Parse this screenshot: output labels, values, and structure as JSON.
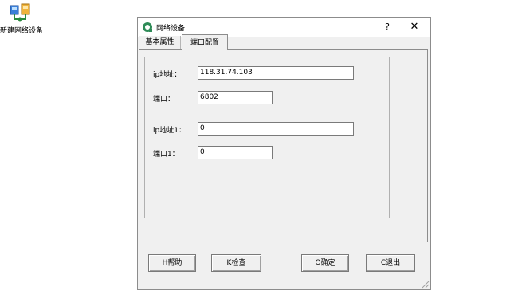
{
  "desktop": {
    "icon_name": "network-device-icon",
    "label": "新建网络设备"
  },
  "dialog": {
    "title": "网络设备",
    "help_glyph": "?",
    "close_glyph": "✕",
    "tabs": [
      {
        "label": "基本属性",
        "active": false
      },
      {
        "label": "端口配置",
        "active": true
      }
    ],
    "fields": {
      "ip_label": "ip地址：",
      "ip_value": "118.31.74.103",
      "port_label": "端口：",
      "port_value": "6802",
      "ip1_label": "ip地址1：",
      "ip1_value": "0",
      "port1_label": "端口1：",
      "port1_value": "0"
    },
    "buttons": {
      "help": "H帮助",
      "check": "K检查",
      "ok": "O确定",
      "cancel": "C退出"
    }
  },
  "colors": {
    "window_bg": "#f0f0f0",
    "titlebar_bg": "#ffffff",
    "border": "#8c8c8c"
  }
}
